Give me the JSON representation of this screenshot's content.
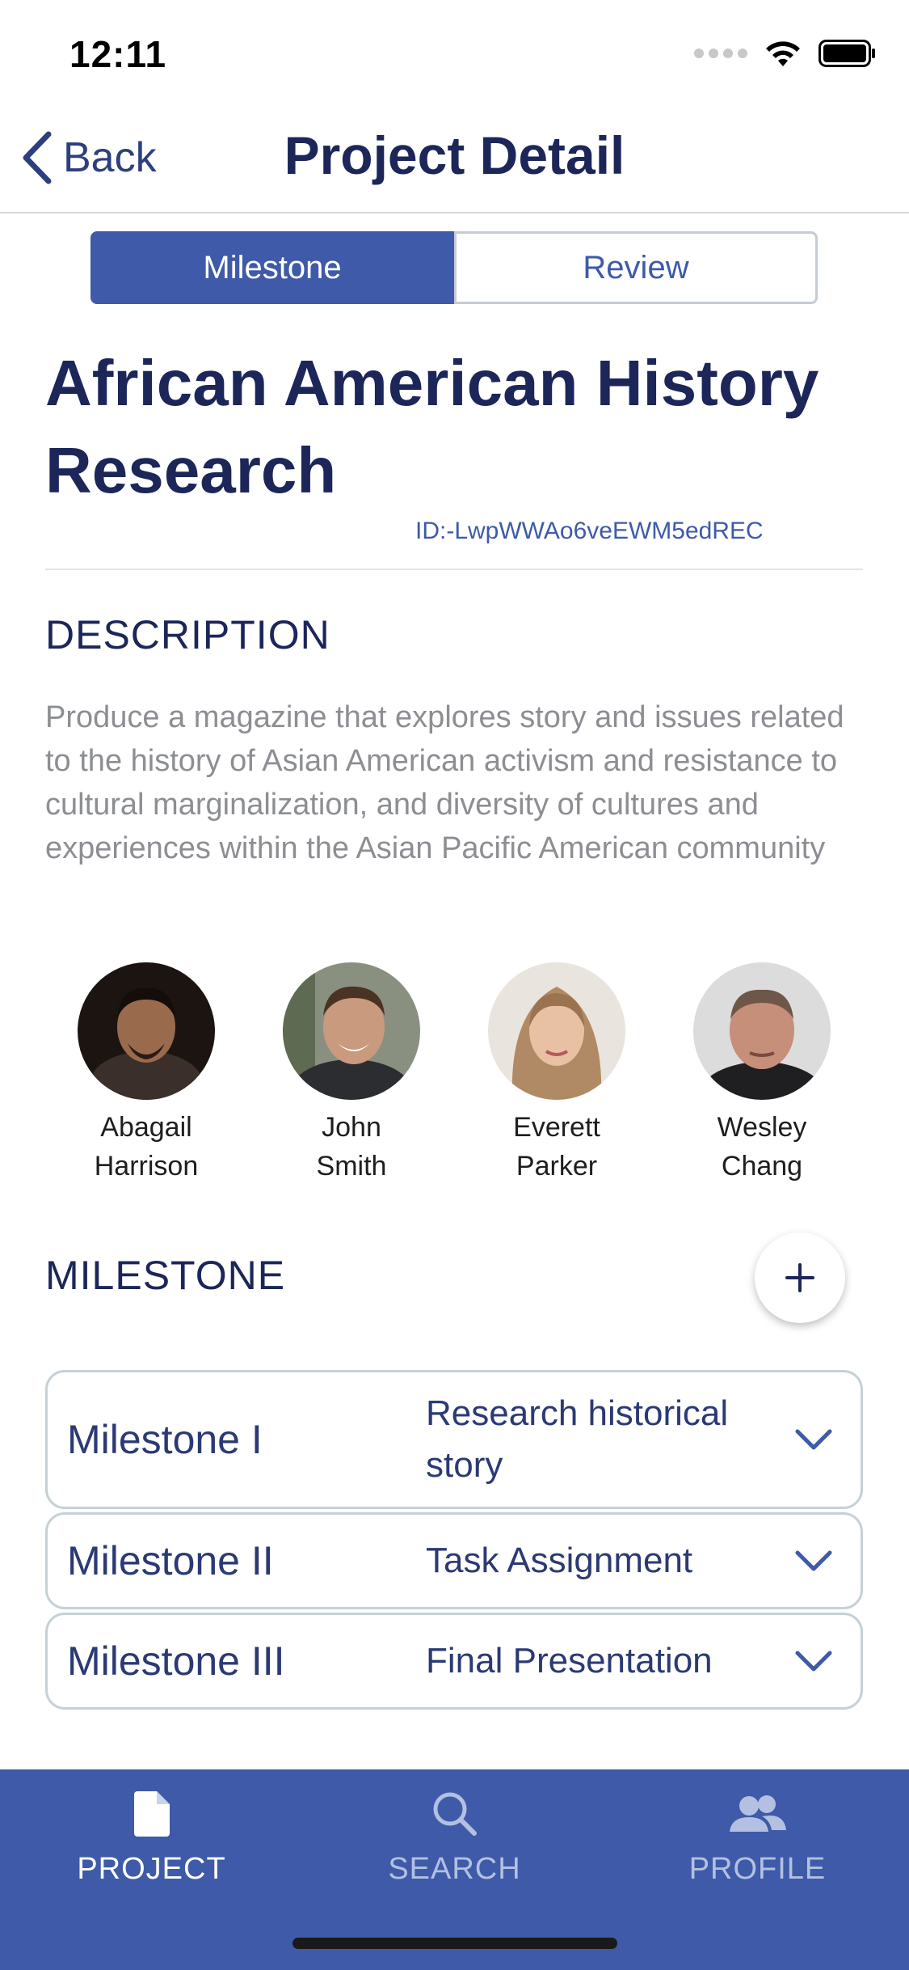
{
  "status_bar": {
    "time": "12:11"
  },
  "nav": {
    "back_label": "Back",
    "title": "Project Detail"
  },
  "segments": {
    "active": "Milestone",
    "inactive": "Review"
  },
  "project": {
    "title": "African American History Research",
    "id_text": "ID:-LwpWWAo6veEWM5edREC"
  },
  "description": {
    "heading": "DESCRIPTION",
    "text": "Produce a magazine that explores story and issues related to the history of Asian American activism and resistance to cultural marginalization, and diversity of cultures and experiences within the Asian Pacific American community"
  },
  "team": [
    {
      "first": "Abagail",
      "last": "Harrison"
    },
    {
      "first": "John",
      "last": "Smith"
    },
    {
      "first": "Everett",
      "last": "Parker"
    },
    {
      "first": "Wesley",
      "last": "Chang"
    }
  ],
  "milestones": {
    "heading": "MILESTONE",
    "items": [
      {
        "name": "Milestone I",
        "description": "Research historical story"
      },
      {
        "name": "Milestone II",
        "description": "Task Assignment"
      },
      {
        "name": "Milestone III",
        "description": "Final Presentation"
      }
    ]
  },
  "tabs": [
    {
      "label": "PROJECT",
      "icon": "document-icon"
    },
    {
      "label": "SEARCH",
      "icon": "search-icon"
    },
    {
      "label": "PROFILE",
      "icon": "people-icon"
    }
  ],
  "colors": {
    "accent": "#3e5aa8",
    "title": "#1c2659",
    "muted": "#8c8e93"
  }
}
